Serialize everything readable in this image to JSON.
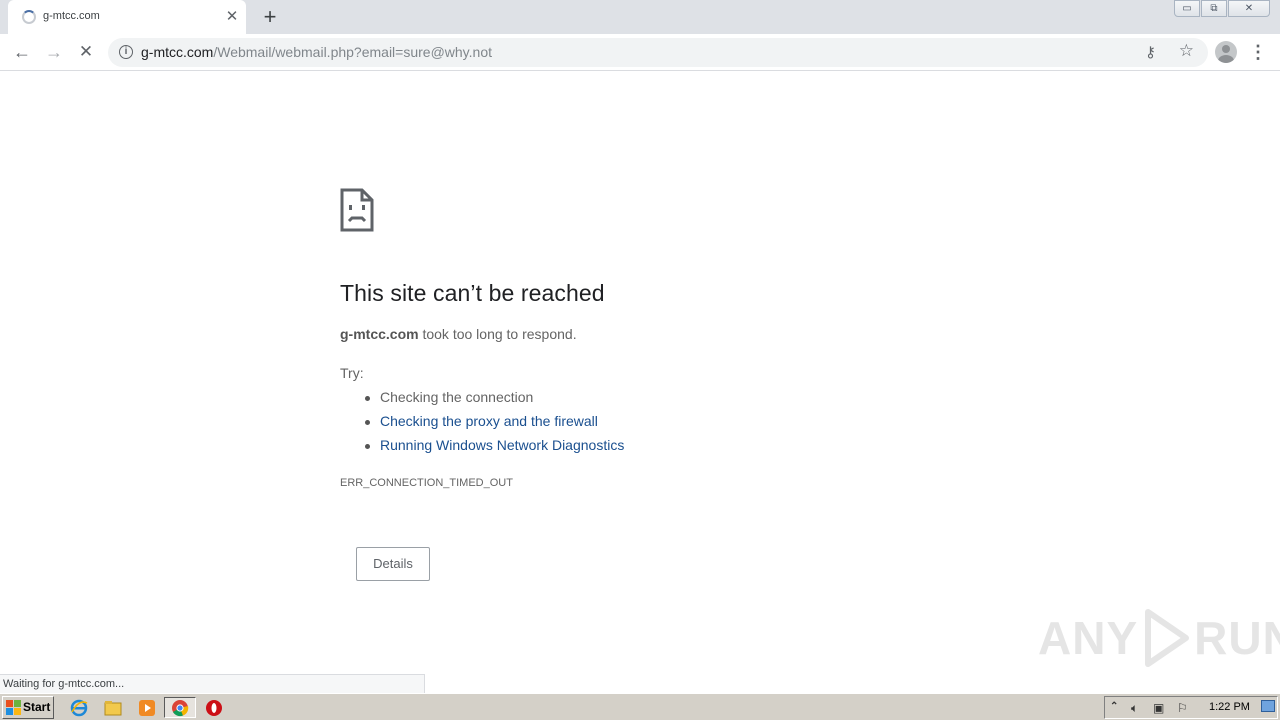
{
  "window": {
    "tab_title": "g-mtcc.com",
    "tab_close_glyph": "✕",
    "new_tab_glyph": "+",
    "controls": {
      "minimize": "▭",
      "restore": "⧉",
      "close": "✕"
    }
  },
  "toolbar": {
    "back_glyph": "←",
    "forward_glyph": "→",
    "stop_glyph": "✕",
    "url_host": "g-mtcc.com",
    "url_path": "/Webmail/webmail.php?email=sure@why.not",
    "key_glyph": "⚷",
    "star_glyph": "☆",
    "menu_glyph": "⋮"
  },
  "error": {
    "title": "This site can’t be reached",
    "host": "g-mtcc.com",
    "desc_suffix": " took too long to respond.",
    "try_label": "Try:",
    "suggestions": [
      "Checking the connection",
      "Checking the proxy and the firewall",
      "Running Windows Network Diagnostics"
    ],
    "code": "ERR_CONNECTION_TIMED_OUT",
    "details_label": "Details"
  },
  "watermark": {
    "left": "ANY",
    "right": "RUN"
  },
  "status_text": "Waiting for g-mtcc.com...",
  "taskbar": {
    "start_label": "Start",
    "clock": "1:22 PM",
    "icons": [
      "ie-icon",
      "explorer-icon",
      "media-player-icon",
      "chrome-icon",
      "opera-icon"
    ]
  },
  "colors": {
    "tabstrip": "#dee1e6",
    "link": "#1a4f8f",
    "title_text": "#202124",
    "body_text": "#646464",
    "taskbar": "#d4d0c8"
  }
}
